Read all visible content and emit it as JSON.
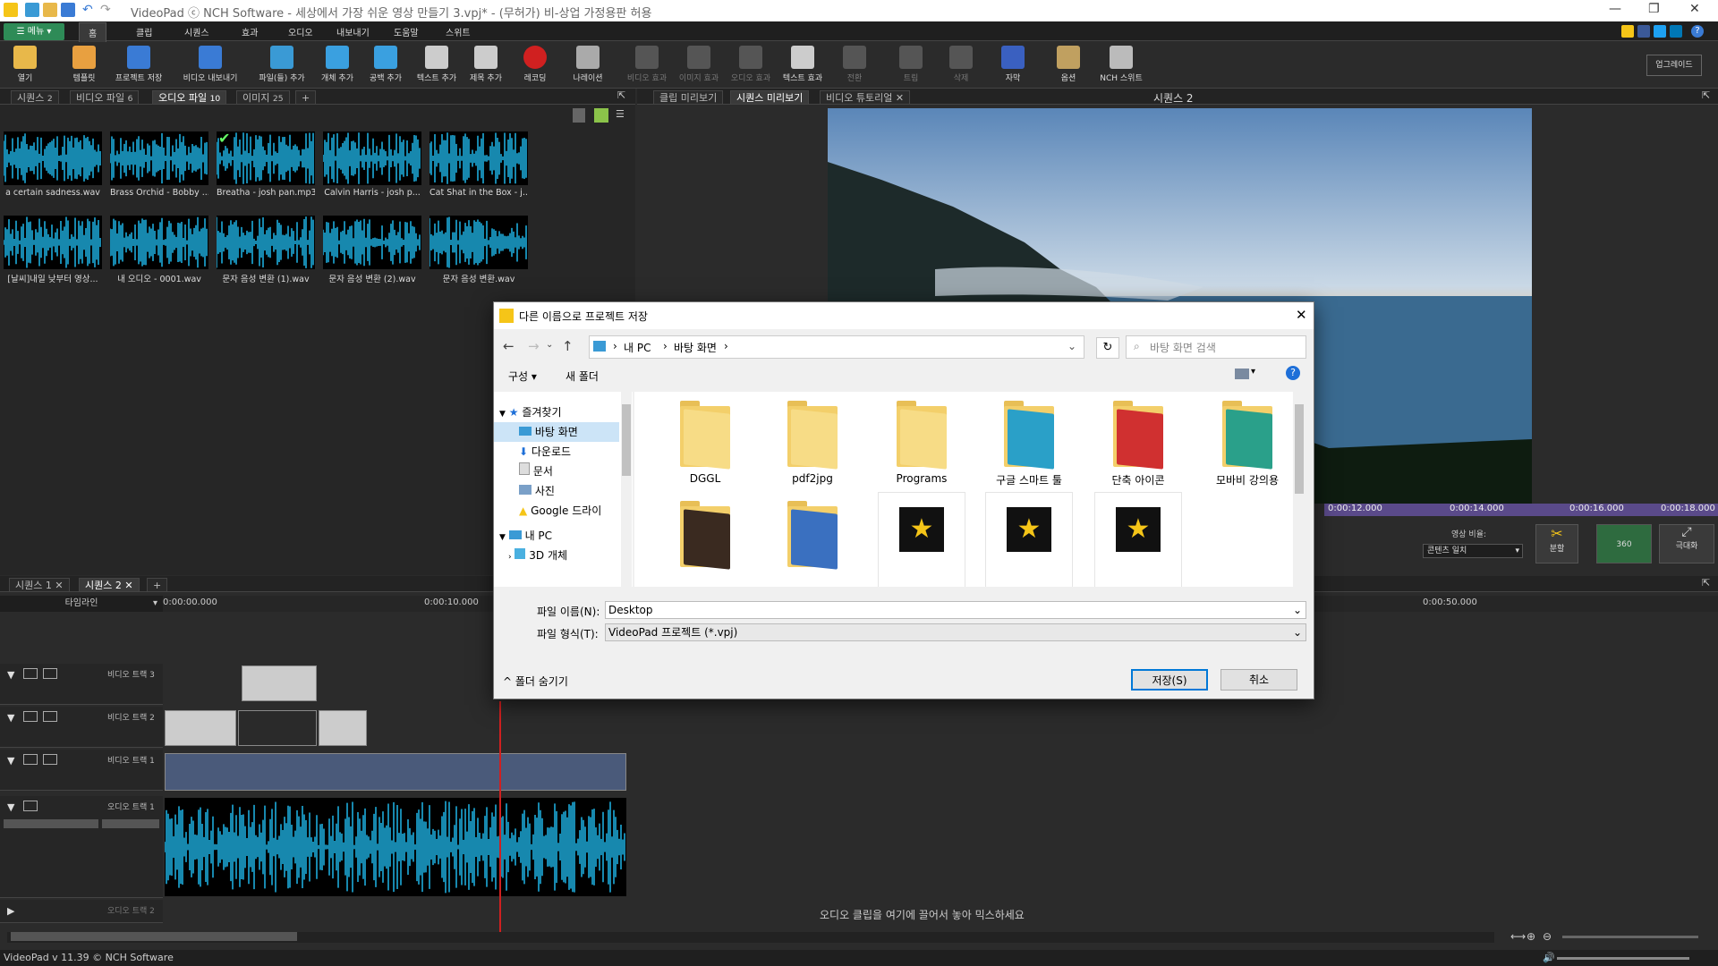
{
  "app": {
    "title": "VideoPad ⓒ NCH Software - 세상에서 가장 쉬운 영상 만들기 3.vpj* - (무허가) 비-상업 가정용판 허용"
  },
  "menubar": {
    "menu_label": "메뉴",
    "tabs": [
      "홈",
      "클립",
      "시퀀스",
      "효과",
      "오디오",
      "내보내기",
      "도움말",
      "스위트"
    ],
    "active_tab": "홈"
  },
  "toolbar": {
    "buttons": [
      {
        "label": "열기",
        "color": "#e8b84a"
      },
      {
        "label": "템플릿",
        "color": "#e8a040"
      },
      {
        "label": "프로젝트 저장",
        "color": "#3a7bd5"
      },
      {
        "label": "비디오 내보내기",
        "color": "#3a7bd5"
      },
      {
        "label": "파일(들) 추가",
        "color": "#3a9ad5"
      },
      {
        "label": "개체 추가",
        "color": "#3aa0e0"
      },
      {
        "label": "공백 추가",
        "color": "#3aa0e0"
      },
      {
        "label": "텍스트 추가",
        "color": "#cccccc"
      },
      {
        "label": "제목 추가",
        "color": "#cccccc"
      },
      {
        "label": "레코딩",
        "color": "#d02020"
      },
      {
        "label": "나레이션",
        "color": "#aaaaaa"
      },
      {
        "label": "비디오 효과",
        "color": "#555555"
      },
      {
        "label": "이미지 효과",
        "color": "#555555"
      },
      {
        "label": "오디오 효과",
        "color": "#555555"
      },
      {
        "label": "텍스트 효과",
        "color": "#cccccc"
      },
      {
        "label": "전환",
        "color": "#555555"
      },
      {
        "label": "트림",
        "color": "#555555"
      },
      {
        "label": "삭제",
        "color": "#555555"
      },
      {
        "label": "자막",
        "color": "#3a60c0"
      },
      {
        "label": "옵션",
        "color": "#c0a060"
      },
      {
        "label": "NCH 스위트",
        "color": "#bbbbbb"
      }
    ],
    "upgrade_label": "업그레이드"
  },
  "media_panel": {
    "tabs": [
      "시퀀스",
      "비디오 파일",
      "오디오 파일",
      "이미지"
    ],
    "tab_counts": [
      "2",
      "6",
      "10",
      "25"
    ],
    "active_tab": "오디오 파일",
    "items": [
      "a certain sadness.wav",
      "Brass Orchid - Bobby ...",
      "Breatha - josh pan.mp3",
      "Calvin Harris - josh p...",
      "Cat Shat in the Box - j...",
      "[날씨]내일 낮부터 영상...",
      "내 오디오 - 0001.wav",
      "문자 음성 변환 (1).wav",
      "문자 음성 변환 (2).wav",
      "문자 음성 변환.wav"
    ]
  },
  "preview_panel": {
    "tabs": [
      "클립 미리보기",
      "시퀀스 미리보기",
      "비디오 튜토리얼"
    ],
    "active_tab": "시퀀스 미리보기",
    "sequence_title": "시퀀스 2",
    "ruler_ticks": [
      "0:00:12.000",
      "0:00:14.000",
      "0:00:16.000",
      "0:00:18.000"
    ],
    "aspect_label": "영상 비율:",
    "aspect_value": "콘텐츠 일치",
    "split_label": "분할",
    "vr_label": "360",
    "maximize_label": "극대화"
  },
  "timeline": {
    "sequence_tabs": [
      "시퀀스 1",
      "시퀀스 2"
    ],
    "active_sequence": "시퀀스 2",
    "mode_label": "타임라인",
    "ruler_ticks": [
      "0:00:00.000",
      "0:00:10.000",
      "0:00:50.000"
    ],
    "tracks": [
      {
        "name": "비디오 트랙 3"
      },
      {
        "name": "비디오 트랙 2"
      },
      {
        "name": "비디오 트랙 1"
      },
      {
        "name": "오디오 트랙 1"
      },
      {
        "name": "오디오 트랙 2"
      }
    ],
    "drop_hint": "오디오 클립을 여기에 끌어서 놓아 믹스하세요"
  },
  "status": {
    "text": "VideoPad v 11.39 © NCH Software"
  },
  "dialog": {
    "title": "다른 이름으로 프로젝트 저장",
    "breadcrumb": [
      "내 PC",
      "바탕 화면"
    ],
    "search_placeholder": "바탕 화면 검색",
    "organize_label": "구성",
    "new_folder_label": "새 폴더",
    "nav": {
      "favorites_label": "즐겨찾기",
      "favorites": [
        "바탕 화면",
        "다운로드",
        "문서",
        "사진",
        "Google 드라이"
      ],
      "pc_label": "내 PC",
      "pc_items": [
        "3D 개체"
      ]
    },
    "files": [
      "DGGL",
      "pdf2jpg",
      "Programs",
      "구글 스마트 툴",
      "단축 아이콘",
      "모바비 강의용"
    ],
    "filename_label": "파일 이름(N):",
    "filename_value": "Desktop",
    "filetype_label": "파일 형식(T):",
    "filetype_value": "VideoPad 프로젝트 (*.vpj)",
    "hide_folders_label": "폴더 숨기기",
    "save_label": "저장(S)",
    "cancel_label": "취소"
  }
}
